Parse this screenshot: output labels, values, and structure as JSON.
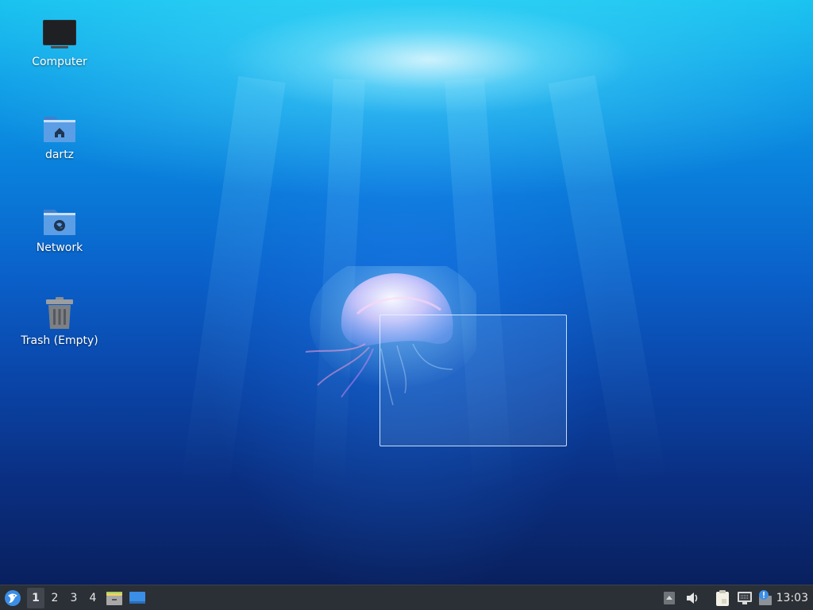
{
  "desktop": {
    "icons": [
      {
        "label": "Computer",
        "icon": "computer-icon"
      },
      {
        "label": "dartz",
        "icon": "home-folder-icon"
      },
      {
        "label": "Network",
        "icon": "network-folder-icon"
      },
      {
        "label": "Trash (Empty)",
        "icon": "trash-icon"
      }
    ]
  },
  "panel": {
    "workspaces": [
      "1",
      "2",
      "3",
      "4"
    ],
    "active_workspace": "1",
    "launchers": [
      "file-manager-icon",
      "show-desktop-icon"
    ],
    "tray": [
      "tray-arrow-icon",
      "volume-icon",
      "clipboard-icon",
      "network-connection-icon",
      "update-notifier-icon"
    ],
    "clock": "13:03"
  },
  "colors": {
    "panel_bg": "#2b2f36",
    "folder_blue": "#5b9ee6",
    "accent": "#3a8ee6"
  }
}
